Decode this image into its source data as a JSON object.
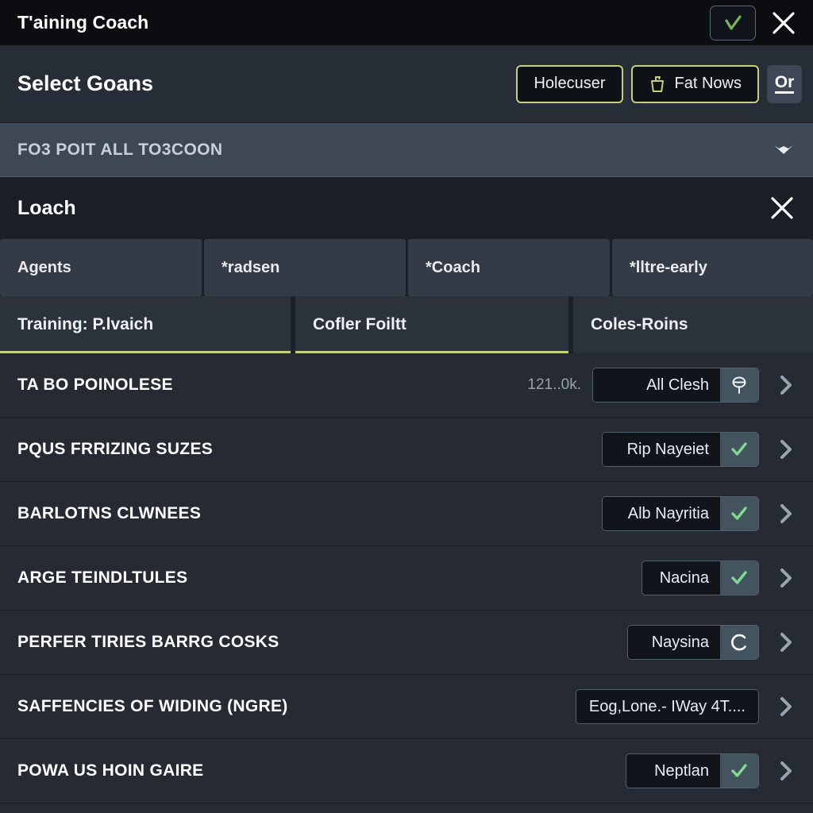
{
  "window": {
    "title": "T'aining Coach",
    "confirm_icon": "check-icon",
    "close_icon": "close-icon"
  },
  "page_header": {
    "title": "Select Goans",
    "buttons": [
      {
        "label": "Holecuser",
        "icon": null
      },
      {
        "label": "Fat Nows",
        "icon": "cup-icon"
      }
    ],
    "link_label": "Or"
  },
  "section_bar": {
    "label": "FO3 POIT ALL TO3COON",
    "chevron_icon": "chevron-down-icon"
  },
  "dialog": {
    "title": "Loach",
    "close_icon": "close-icon"
  },
  "tabs_top": [
    {
      "label": "Agents"
    },
    {
      "label": "*radsen"
    },
    {
      "label": "*Coach"
    },
    {
      "label": "*lltre-early"
    }
  ],
  "tabs_sub": [
    {
      "label": "Training: P.lvaich",
      "active": true
    },
    {
      "label": "Cofler Foiltt",
      "active": true
    },
    {
      "label": "Coles-Roins",
      "active": false
    }
  ],
  "rows": [
    {
      "label": "TA BO POINOLESE",
      "meta": "121..0k.",
      "value": "All Clesh",
      "chip_icon": "lollipop-icon",
      "chevron_icon": "chevron-right-icon"
    },
    {
      "label": "PQUS FRRIZING SUZES",
      "meta": "",
      "value": "Rip Nayeiet",
      "chip_icon": "check-icon",
      "chevron_icon": "chevron-right-icon"
    },
    {
      "label": "BARLOTNS CLWNEES",
      "meta": "",
      "value": "Alb Nayritia",
      "chip_icon": "check-icon",
      "chevron_icon": "chevron-right-icon"
    },
    {
      "label": "ARGE TEINDLTULES",
      "meta": "",
      "value": "Nacina",
      "chip_icon": "check-icon",
      "chevron_icon": "chevron-right-icon"
    },
    {
      "label": "PERFER TIRIES BARRG COSKS",
      "meta": "",
      "value": "Naysina",
      "chip_icon": "spinner-icon",
      "chevron_icon": "chevron-right-icon"
    },
    {
      "label": "SAFFENCIES OF WIDING (NGRE)",
      "meta": "",
      "value": "Eog,Lone.- IWay 4T....",
      "chip_icon": null,
      "chevron_icon": "chevron-right-icon"
    },
    {
      "label": "POWA US HOIN GAIRE",
      "meta": "",
      "value": "Neptlan",
      "chip_icon": "check-icon",
      "chevron_icon": "chevron-right-icon"
    }
  ],
  "colors": {
    "accent_green": "#c3d17e",
    "check_green": "#7fd98f",
    "titlebar_bg": "#0b0d10",
    "header_bg": "#272d37",
    "section_bar_bg": "#3e4754",
    "list_bg": "#262b33"
  }
}
